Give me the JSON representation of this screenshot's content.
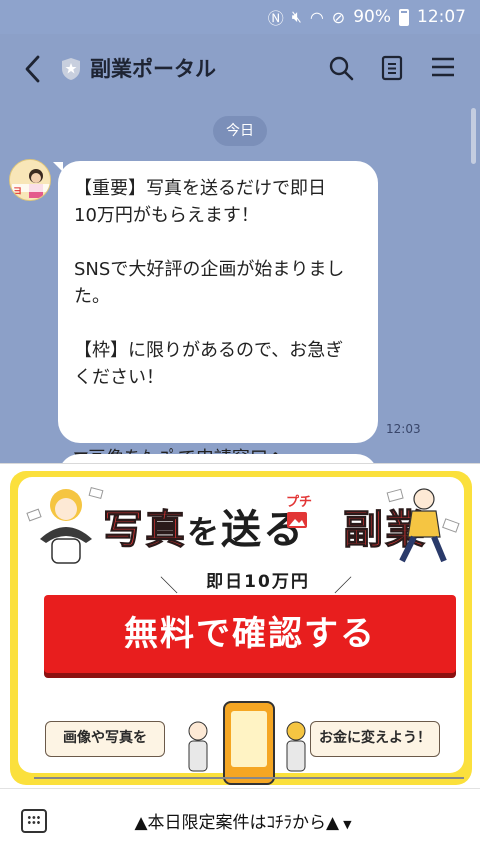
{
  "status_bar": {
    "battery": "90%",
    "time": "12:07"
  },
  "header": {
    "title": "副業ポータル"
  },
  "chat": {
    "date_label": "今日",
    "message_text": "【重要】写真を送るだけで即日\n10万円がもらえます！\n\nSNSで大好評の企画が始まりまし\nた。\n\n【枠】に限りがあるので、お急ぎ\nください！\n\n\n▼画像をﾀｯﾌﾟで申請窓口へ",
    "message_time": "12:03",
    "avatar_text": "ヨ"
  },
  "banner": {
    "headline_1": "写真",
    "headline_wo": "を",
    "headline_2": "送る",
    "headline_3": "副業",
    "puchi": "プチ",
    "sub": "即日10万円",
    "cta": "無料で確認する",
    "left_label": "画像や写真を",
    "right_label": "お金に変えよう！"
  },
  "bottom": {
    "menu_label": "▲本日限定案件はｺﾁﾗから▲"
  },
  "colors": {
    "chat_bg": "#8ca0c8",
    "cta": "#e81e1e",
    "banner_frame": "#fbe03c"
  }
}
